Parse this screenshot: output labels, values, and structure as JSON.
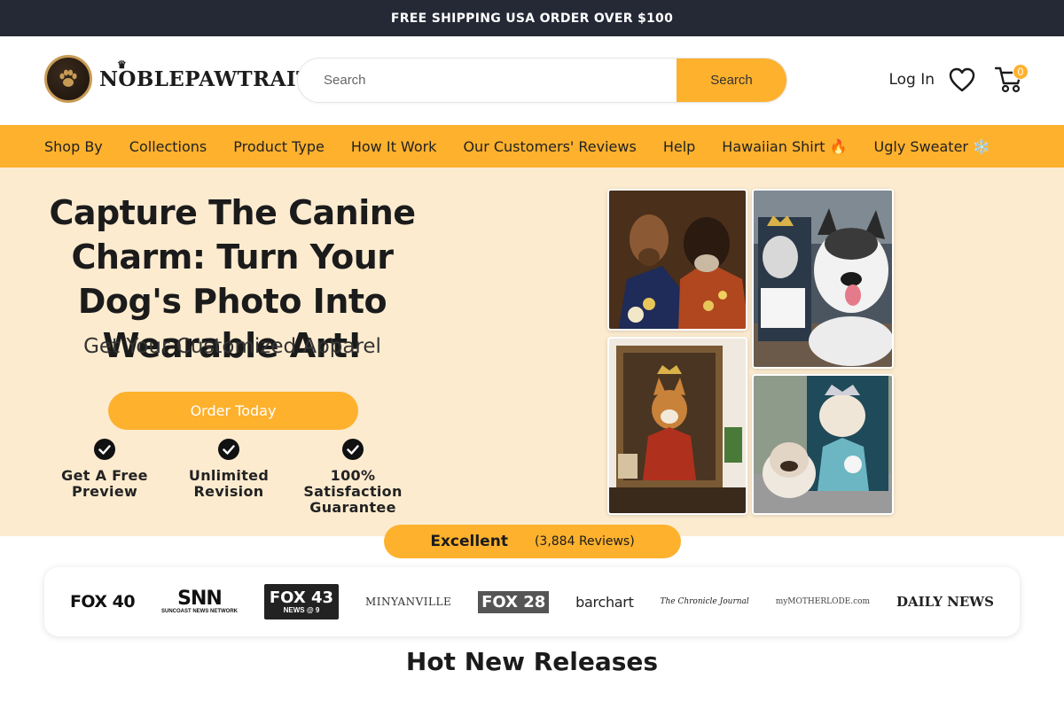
{
  "announcement": "FREE SHIPPING USA ORDER OVER $100",
  "brand": {
    "name": "NOBLEPAWTRAIT",
    "logo_icon": "paw-badge-icon",
    "accent": "#fdb12d",
    "dark": "#252936"
  },
  "search": {
    "placeholder": "Search",
    "button_label": "Search"
  },
  "header": {
    "login_label": "Log In",
    "wishlist_icon": "heart-icon",
    "cart_icon": "cart-icon",
    "cart_count": "0"
  },
  "nav": {
    "items": [
      {
        "label": "Shop By"
      },
      {
        "label": "Collections"
      },
      {
        "label": "Product Type"
      },
      {
        "label": "How It Work"
      },
      {
        "label": "Our Customers' Reviews"
      },
      {
        "label": "Help"
      },
      {
        "label": "Hawaiian Shirt 🔥"
      },
      {
        "label": "Ugly Sweater ❄️"
      }
    ]
  },
  "hero": {
    "title": "Capture The Canine Charm: Turn Your Dog's Photo Into Wearable Art!",
    "subtitle": "Get Your Customized Apparel",
    "cta_label": "Order Today",
    "features": [
      {
        "label": "Get A Free Preview",
        "icon": "check-circle-icon"
      },
      {
        "label": "Unlimited Revision",
        "icon": "check-circle-icon"
      },
      {
        "label": "100% Satisfaction Guarantee",
        "icon": "check-circle-icon"
      }
    ]
  },
  "reviews": {
    "rating_label": "Excellent",
    "count_label": "(3,884 Reviews)"
  },
  "press": {
    "logos": [
      {
        "text": "FOX 40"
      },
      {
        "text": "SNN",
        "caption": "SUNCOAST NEWS NETWORK"
      },
      {
        "text": "FOX 43",
        "caption": "NEWS @ 9"
      },
      {
        "text": "MINYANVILLE"
      },
      {
        "text": "FOX 28"
      },
      {
        "text": "barchart"
      },
      {
        "text": "The Chronicle Journal"
      },
      {
        "text": "myMOTHERLODE.com"
      },
      {
        "text": "DAILY NEWS"
      }
    ]
  },
  "sections": {
    "hot_new": "Hot New Releases"
  }
}
